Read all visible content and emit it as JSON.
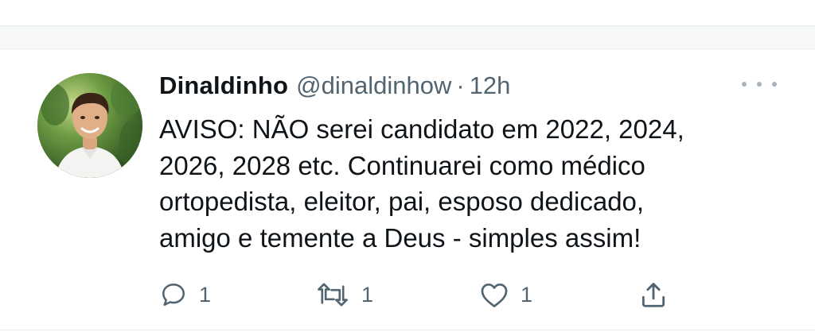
{
  "tweet": {
    "author_name": "Dinaldinho",
    "handle": "@dinaldinhow",
    "separator": "·",
    "time": "12h",
    "text_lines": [
      "AVISO: NÃO serei candidato em 2022, 2024,",
      "2026, 2028 etc. Continuarei como médico",
      "ortopedista, eleitor, pai, esposo dedicado,",
      "amigo e temente a Deus - simples assim!"
    ],
    "actions": {
      "reply_count": "1",
      "retweet_count": "1",
      "like_count": "1"
    }
  },
  "icons": {
    "more": "more-horizontal-icon",
    "reply": "reply-icon",
    "retweet": "retweet-icon",
    "like": "heart-icon",
    "share": "share-icon"
  },
  "colors": {
    "text_primary": "#0f1419",
    "text_secondary": "#536471",
    "divider": "#e6ecf0",
    "background_band": "#f7f9f9"
  }
}
